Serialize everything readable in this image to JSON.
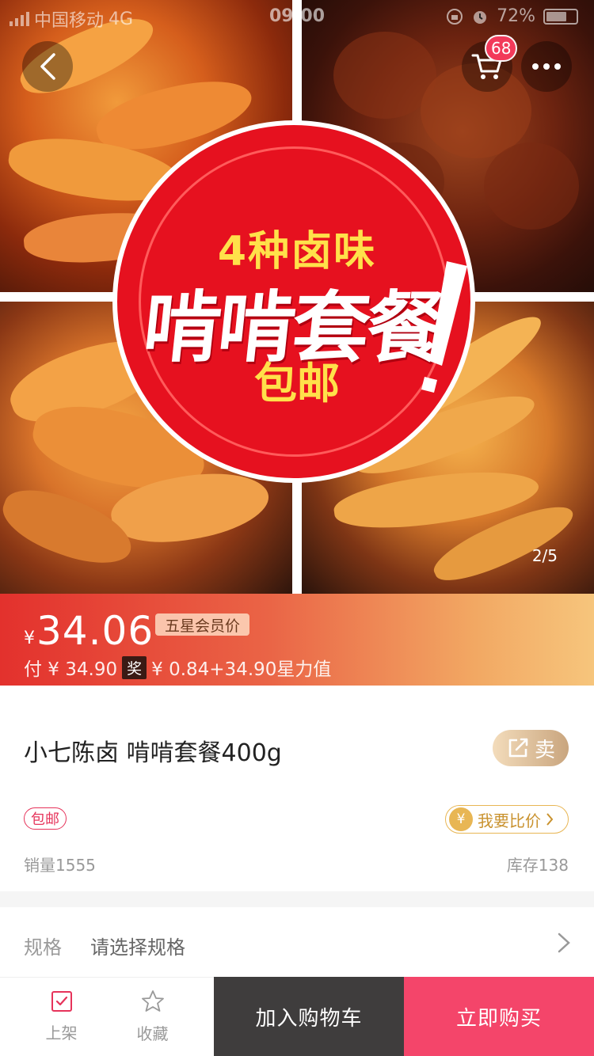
{
  "status_bar": {
    "carrier": "中国移动",
    "network": "4G",
    "time": "09:00",
    "battery": "72%"
  },
  "nav": {
    "cart_count": "68",
    "image_index": "2/5"
  },
  "hero_badge": {
    "line1": "4种卤味",
    "line2": "啃啃套餐",
    "line3": "包邮"
  },
  "price": {
    "currency": "¥",
    "value": "34.06",
    "member_tag": "五星会员价",
    "pay_text": "付 ¥ 34.90",
    "reward_badge": "奖",
    "reward_text": "¥ 0.84+34.90星力值"
  },
  "product": {
    "title": "小七陈卤 啃啃套餐400g",
    "sell_label": "卖",
    "free_shipping": "包邮",
    "compare_label": "我要比价",
    "coin_symbol": "¥",
    "sales": "销量1555",
    "stock": "库存138"
  },
  "spec": {
    "label": "规格",
    "value": "请选择规格"
  },
  "bottom_bar": {
    "shelf_label": "上架",
    "favorite_label": "收藏",
    "add_to_cart": "加入购物车",
    "buy_now": "立即购买"
  },
  "colors": {
    "accent_red": "#e6111f",
    "buy_pink": "#f4456a",
    "cart_dark": "#3f3d3d",
    "gold": "#e8b654"
  }
}
